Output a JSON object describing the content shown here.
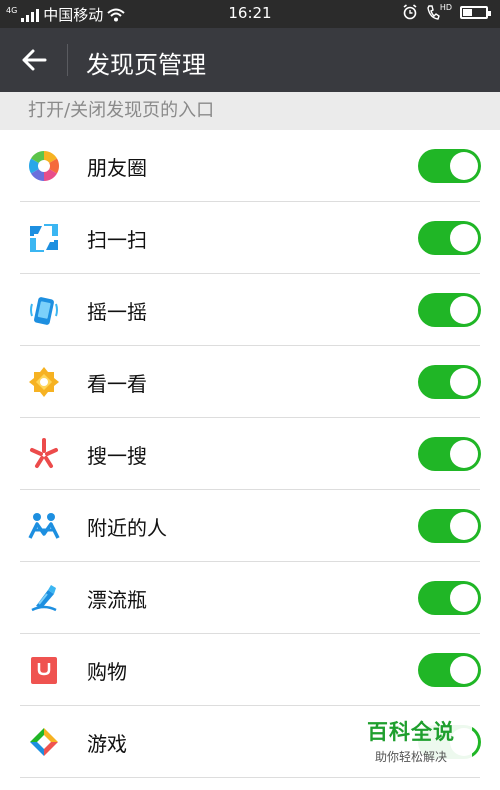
{
  "status_bar": {
    "carrier": "中国移动",
    "time": "16:21",
    "network_tag": "4G",
    "hd_tag": "HD"
  },
  "header": {
    "title": "发现页管理"
  },
  "section": {
    "title": "打开/关闭发现页的入口"
  },
  "items": [
    {
      "label": "朋友圈",
      "enabled": true
    },
    {
      "label": "扫一扫",
      "enabled": true
    },
    {
      "label": "摇一摇",
      "enabled": true
    },
    {
      "label": "看一看",
      "enabled": true
    },
    {
      "label": "搜一搜",
      "enabled": true
    },
    {
      "label": "附近的人",
      "enabled": true
    },
    {
      "label": "漂流瓶",
      "enabled": true
    },
    {
      "label": "购物",
      "enabled": true
    },
    {
      "label": "游戏",
      "enabled": true
    }
  ],
  "watermark": {
    "main": "百科全说",
    "sub": "助你轻松解决"
  },
  "colors": {
    "toggle_on": "#20b626",
    "title_bar": "#393a3f",
    "status_bar": "#2b2b2b"
  }
}
